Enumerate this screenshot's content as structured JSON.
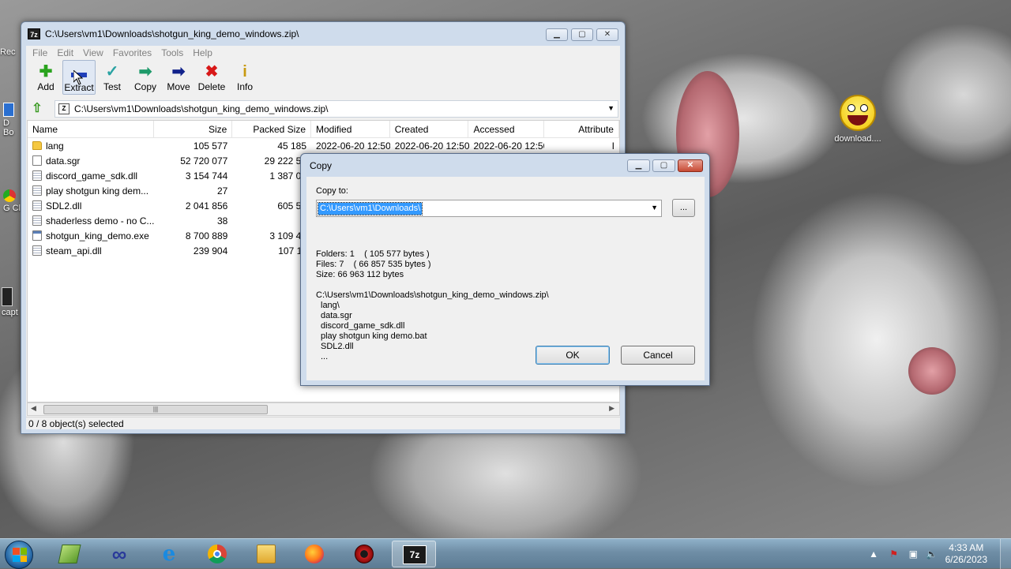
{
  "desktop": {
    "icons": [
      {
        "label": "Rec",
        "name": "recycle-bin"
      },
      {
        "label": "D Bo",
        "name": "desktop-icon-d"
      },
      {
        "label": "G Cl",
        "name": "desktop-icon-g"
      },
      {
        "label": "capt",
        "name": "desktop-icon-capt"
      },
      {
        "label": "download....",
        "name": "download-emoji"
      }
    ]
  },
  "window": {
    "title": "C:\\Users\\vm1\\Downloads\\shotgun_king_demo_windows.zip\\",
    "app_icon": "7z",
    "menu": [
      "File",
      "Edit",
      "View",
      "Favorites",
      "Tools",
      "Help"
    ],
    "toolbar": [
      {
        "label": "Add",
        "icon": "plus-icon",
        "glyph": "✚",
        "color": "#2aa31e"
      },
      {
        "label": "Extract",
        "icon": "minus-icon",
        "glyph": "▬",
        "color": "#1f3fb8"
      },
      {
        "label": "Test",
        "icon": "check-icon",
        "glyph": "✓",
        "color": "#2ba3a3"
      },
      {
        "label": "Copy",
        "icon": "arrow-right-icon",
        "glyph": "➡",
        "color": "#1e9a6a"
      },
      {
        "label": "Move",
        "icon": "arrow-right-icon",
        "glyph": "➡",
        "color": "#12238c"
      },
      {
        "label": "Delete",
        "icon": "delete-x-icon",
        "glyph": "✖",
        "color": "#d81818"
      },
      {
        "label": "Info",
        "icon": "info-icon",
        "glyph": "i",
        "color": "#c89a10"
      }
    ],
    "address": "C:\\Users\\vm1\\Downloads\\shotgun_king_demo_windows.zip\\",
    "columns": [
      "Name",
      "Size",
      "Packed Size",
      "Modified",
      "Created",
      "Accessed",
      "Attribute"
    ],
    "rows": [
      {
        "type": "folder",
        "name": "lang",
        "size": "105 577",
        "packed": "45 185",
        "modified": "2022-06-20 12:50",
        "created": "2022-06-20 12:50",
        "accessed": "2022-06-20 12:50",
        "attr": "I"
      },
      {
        "type": "file",
        "name": "data.sgr",
        "size": "52 720 077",
        "packed": "29 222 50",
        "modified": "",
        "created": "",
        "accessed": "",
        "attr": ""
      },
      {
        "type": "dll",
        "name": "discord_game_sdk.dll",
        "size": "3 154 744",
        "packed": "1 387 08",
        "modified": "",
        "created": "",
        "accessed": "",
        "attr": ""
      },
      {
        "type": "dll",
        "name": "play shotgun king dem...",
        "size": "27",
        "packed": "2",
        "modified": "",
        "created": "",
        "accessed": "",
        "attr": ""
      },
      {
        "type": "dll",
        "name": "SDL2.dll",
        "size": "2 041 856",
        "packed": "605 51",
        "modified": "",
        "created": "",
        "accessed": "",
        "attr": ""
      },
      {
        "type": "dll",
        "name": "shaderless demo - no C...",
        "size": "38",
        "packed": "3",
        "modified": "",
        "created": "",
        "accessed": "",
        "attr": ""
      },
      {
        "type": "exe",
        "name": "shotgun_king_demo.exe",
        "size": "8 700 889",
        "packed": "3 109 44",
        "modified": "",
        "created": "",
        "accessed": "",
        "attr": ""
      },
      {
        "type": "dll",
        "name": "steam_api.dll",
        "size": "239 904",
        "packed": "107 11",
        "modified": "",
        "created": "",
        "accessed": "",
        "attr": ""
      }
    ],
    "status": "0 / 8 object(s) selected"
  },
  "dialog": {
    "title": "Copy",
    "copy_to_label": "Copy to:",
    "path": "C:\\Users\\vm1\\Downloads\\",
    "browse_label": "...",
    "folders": "Folders: 1    ( 105 577 bytes )",
    "files": "Files: 7    ( 66 857 535 bytes )",
    "size": "Size: 66 963 112 bytes",
    "source": "C:\\Users\\vm1\\Downloads\\shotgun_king_demo_windows.zip\\",
    "items": [
      "lang\\",
      "data.sgr",
      "discord_game_sdk.dll",
      "play shotgun king demo.bat",
      "SDL2.dll",
      "..."
    ],
    "ok_label": "OK",
    "cancel_label": "Cancel"
  },
  "taskbar": {
    "time": "4:33 AM",
    "date": "6/26/2023",
    "apps": [
      "green-app",
      "infinity-app",
      "internet-explorer",
      "chrome",
      "file-explorer",
      "firefox",
      "red-gear-app",
      "7zip"
    ]
  }
}
